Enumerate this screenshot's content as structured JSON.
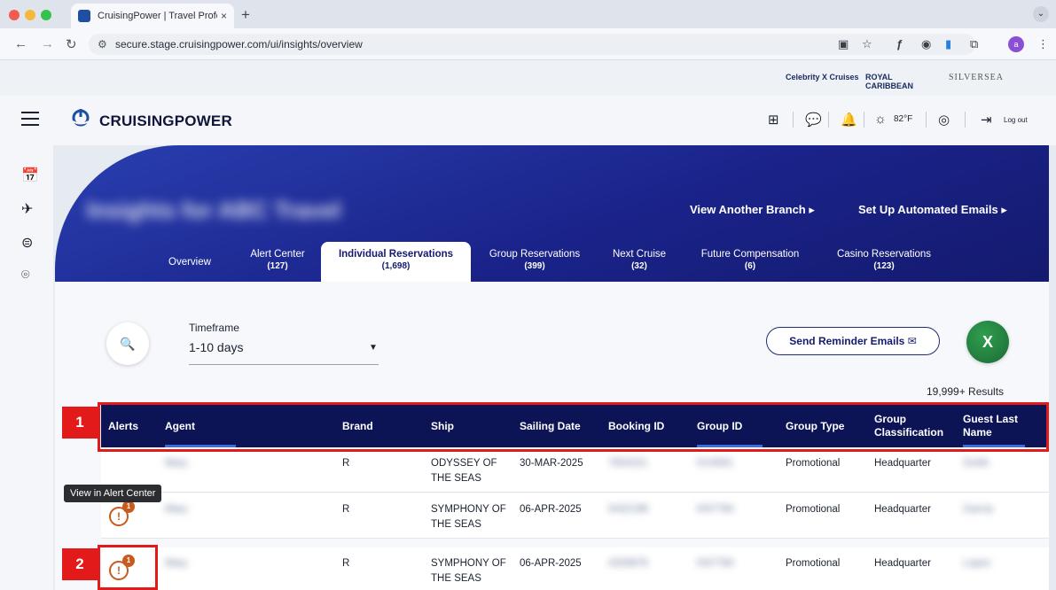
{
  "browser": {
    "tab_title": "CruisingPower | Travel Profes",
    "tab_close": "×",
    "new_tab": "+",
    "url": "secure.stage.cruisingpower.com/ui/insights/overview",
    "profile_initial": "a",
    "traffic_colors": [
      "#f25b50",
      "#f6b83c",
      "#36c24a"
    ]
  },
  "brand_strip": {
    "celebrity": "Celebrity X Cruises",
    "royal": "ROYAL CARIBBEAN",
    "silversea": "SILVERSEA"
  },
  "header": {
    "logo_text": "CRUISINGPOWER",
    "temperature": "82°F",
    "logout": "Log out"
  },
  "hero": {
    "title": "Insights for ABC Travel",
    "view_branch": "View Another Branch ▸",
    "automated_emails": "Set Up Automated Emails ▸",
    "tabs": [
      {
        "label": "Overview",
        "count": ""
      },
      {
        "label": "Alert Center",
        "count": "(127)"
      },
      {
        "label": "Individual Reservations",
        "count": "(1,698)"
      },
      {
        "label": "Group Reservations",
        "count": "(399)"
      },
      {
        "label": "Next Cruise",
        "count": "(32)"
      },
      {
        "label": "Future Compensation",
        "count": "(6)"
      },
      {
        "label": "Casino Reservations",
        "count": "(123)"
      }
    ]
  },
  "filters": {
    "timeframe_label": "Timeframe",
    "timeframe_value": "1-10 days",
    "reminder_button": "Send Reminder Emails ✉",
    "excel_label": "X",
    "results": "19,999+ Results"
  },
  "table": {
    "columns": [
      "Alerts",
      "Agent",
      "Brand",
      "Ship",
      "Sailing Date",
      "Booking ID",
      "Group ID",
      "Group Type",
      "Group Classification",
      "Guest Last Name"
    ],
    "rows": [
      {
        "alert": "",
        "agent": "Mary",
        "brand": "R",
        "ship": "ODYSSEY OF THE SEAS",
        "date": "30-MAR-2025",
        "booking": "7654321",
        "group": "KX4561",
        "type": "Promotional",
        "classification": "Headquarter",
        "guest": "Smith"
      },
      {
        "alert": "1",
        "agent": "Mary",
        "brand": "R",
        "ship": "SYMPHONY OF THE SEAS",
        "date": "06-APR-2025",
        "booking": "5432198",
        "group": "KN7784",
        "type": "Promotional",
        "classification": "Headquarter",
        "guest": "Garcia"
      },
      {
        "alert": "1",
        "agent": "Mary",
        "brand": "R",
        "ship": "SYMPHONY OF THE SEAS",
        "date": "06-APR-2025",
        "booking": "4329876",
        "group": "KN7784",
        "type": "Promotional",
        "classification": "Headquarter",
        "guest": "Lopez"
      }
    ]
  },
  "tooltip": "View in Alert Center",
  "annotations": {
    "one": "1",
    "two": "2"
  }
}
